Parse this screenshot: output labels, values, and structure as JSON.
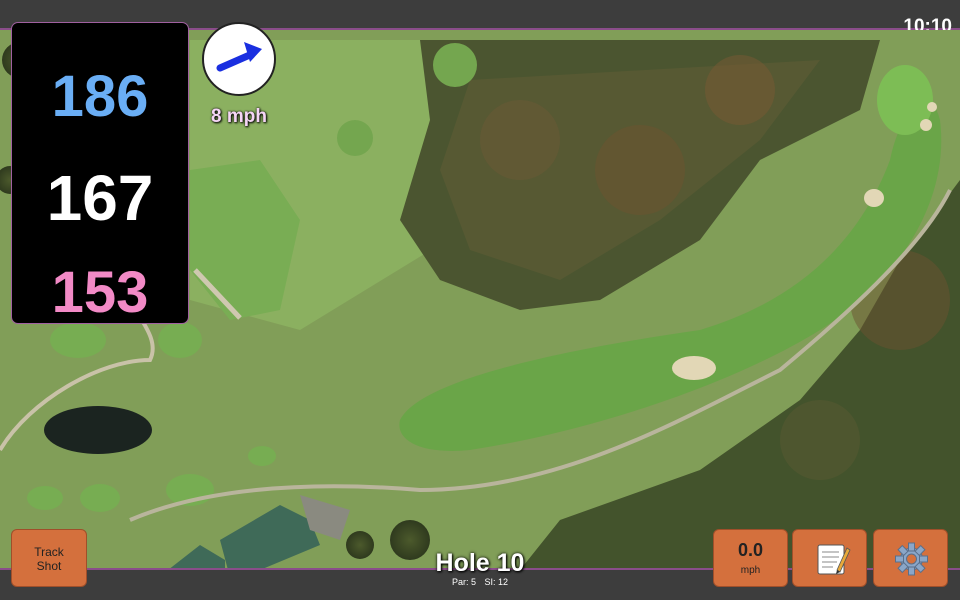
{
  "status": {
    "time": "10:10"
  },
  "distances": {
    "back": "186",
    "middle": "167",
    "front": "153"
  },
  "wind": {
    "speed": "8 mph",
    "icon": "wind-arrow-icon"
  },
  "buttons": {
    "track_shot": "Track Shot",
    "speed_value": "0.0",
    "speed_unit": "mph",
    "notes_icon": "notepad-icon",
    "settings_icon": "gear-icon"
  },
  "hole": {
    "title": "Hole 10",
    "par": "Par: 5",
    "si": "SI: 12"
  },
  "colors": {
    "accent": "#d4703d",
    "back": "#6aaef5",
    "front": "#f28ac6",
    "border": "#8a4d8a"
  }
}
